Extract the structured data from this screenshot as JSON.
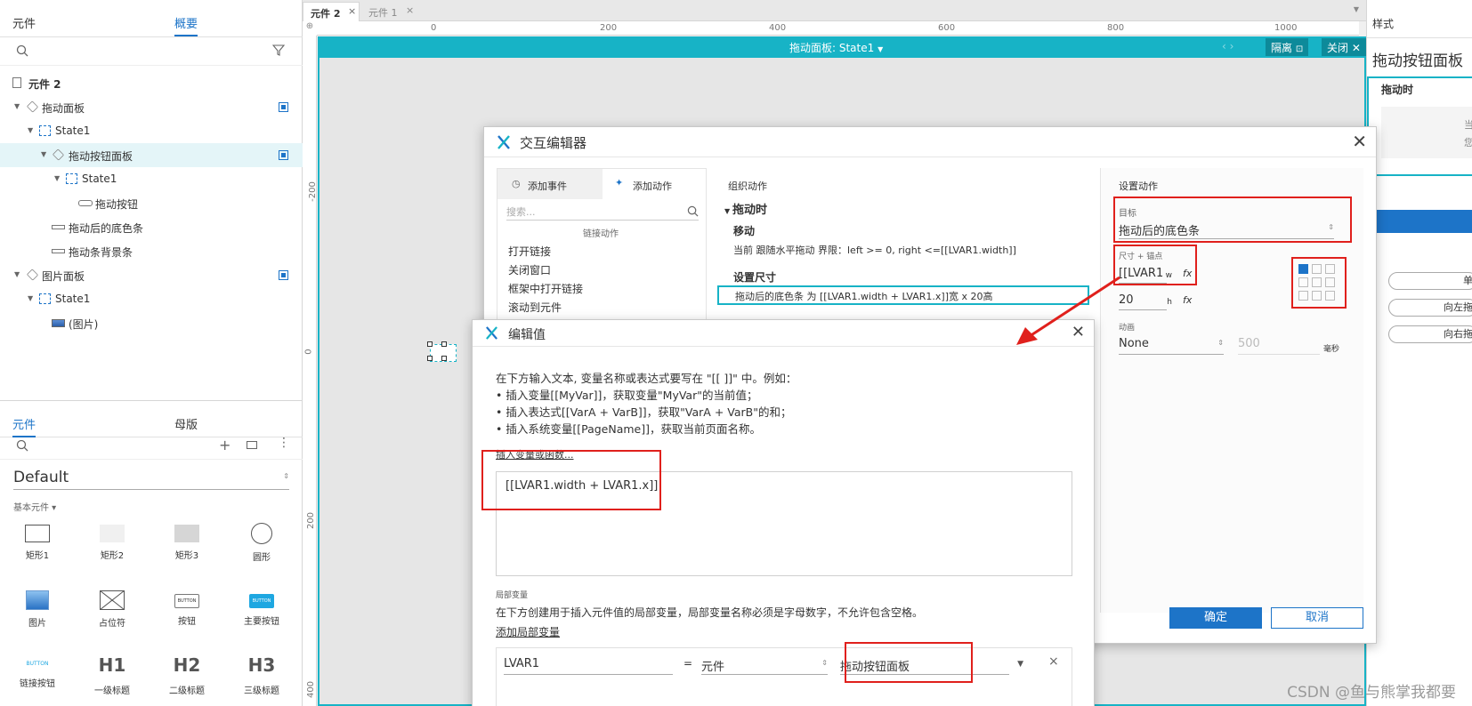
{
  "left": {
    "top_tabs": [
      "元件",
      "概要"
    ],
    "tree": [
      {
        "label": "元件 2"
      },
      {
        "label": "拖动面板"
      },
      {
        "label": "State1"
      },
      {
        "label": "拖动按钮面板"
      },
      {
        "label": "State1"
      },
      {
        "label": "拖动按钮"
      },
      {
        "label": "拖动后的底色条"
      },
      {
        "label": "拖动条背景条"
      },
      {
        "label": "图片面板"
      },
      {
        "label": "State1"
      },
      {
        "label": "(图片)"
      }
    ],
    "bottom_tabs": [
      "元件",
      "母版"
    ],
    "library": "Default",
    "section": "基本元件 ▾",
    "widgets": [
      "矩形1",
      "矩形2",
      "矩形3",
      "圆形",
      "图片",
      "占位符",
      "按钮",
      "主要按钮",
      "链接按钮",
      "一级标题",
      "二级标题",
      "三级标题"
    ],
    "widget_texts": {
      "button": "BUTTON",
      "primary_button": "BUTTON",
      "link_button": "BUTTON",
      "h1": "H1",
      "h2": "H2",
      "h3": "H3"
    }
  },
  "canvas": {
    "tabs": [
      "元件 2",
      "元件 1"
    ],
    "ruler_h": [
      "0",
      "200",
      "400",
      "600",
      "800",
      "1000"
    ],
    "ruler_v": [
      "-200",
      "0",
      "200",
      "400"
    ],
    "state_bar": {
      "title": "拖动面板: State1",
      "isolate": "隔离",
      "close": "关闭"
    }
  },
  "interaction_editor": {
    "title": "交互编辑器",
    "tab_add_event": "添加事件",
    "tab_add_action": "添加动作",
    "search_placeholder": "搜索...",
    "category": "链接动作",
    "actions": [
      "打开链接",
      "关闭窗口",
      "框架中打开链接",
      "滚动到元件"
    ],
    "organize_header": "组织动作",
    "event": "拖动时",
    "group1_title": "移动",
    "group1_desc": "当前 跟随水平拖动 界限：left >= 0, right <=[[LVAR1.width]]",
    "group2_title": "设置尺寸",
    "group2_desc": "拖动后的底色条 为 [[LVAR1.width + LVAR1.x]]宽 x 20高",
    "setup_header": "设置动作",
    "target_label": "目标",
    "target_value": "拖动后的底色条",
    "size_label": "尺寸 + 锚点",
    "width_value": "[[LVAR1",
    "width_unit": "w",
    "height_value": "20",
    "height_unit": "h",
    "fx": "fx",
    "anim_label": "动画",
    "anim_value": "None",
    "duration_value": "500",
    "duration_unit": "毫秒",
    "ok": "确定",
    "cancel": "取消"
  },
  "edit_value": {
    "title": "编辑值",
    "instructions": [
      "在下方输入文本, 变量名称或表达式要写在 \"[[ ]]\" 中。例如：",
      "• 插入变量[[MyVar]]，获取变量\"MyVar\"的当前值；",
      "• 插入表达式[[VarA + VarB]]，获取\"VarA + VarB\"的和；",
      "• 插入系统变量[[PageName]]，获取当前页面名称。"
    ],
    "insert_link": "插入变量或函数...",
    "expression": "[[LVAR1.width + LVAR1.x]]",
    "local_var_header": "局部变量",
    "local_var_desc": "在下方创建用于插入元件值的局部变量，局部变量名称必须是字母数字，不允许包含空格。",
    "add_local_var": "添加局部变量",
    "var_name": "LVAR1",
    "equals": "=",
    "var_type": "元件",
    "var_target": "拖动按钮面板",
    "remove": "×"
  },
  "right": {
    "tab": "样式",
    "title": "拖动按钮面板",
    "event": "拖动时",
    "btn1": "单",
    "btn2": "向左拖",
    "btn3": "向右拖",
    "clip1": "当",
    "clip2": "您"
  },
  "watermark": "CSDN @鱼与熊掌我都要",
  "colors": {
    "accent": "#1d74c8",
    "teal": "#17b3c6",
    "highlight": "#e0201c"
  }
}
